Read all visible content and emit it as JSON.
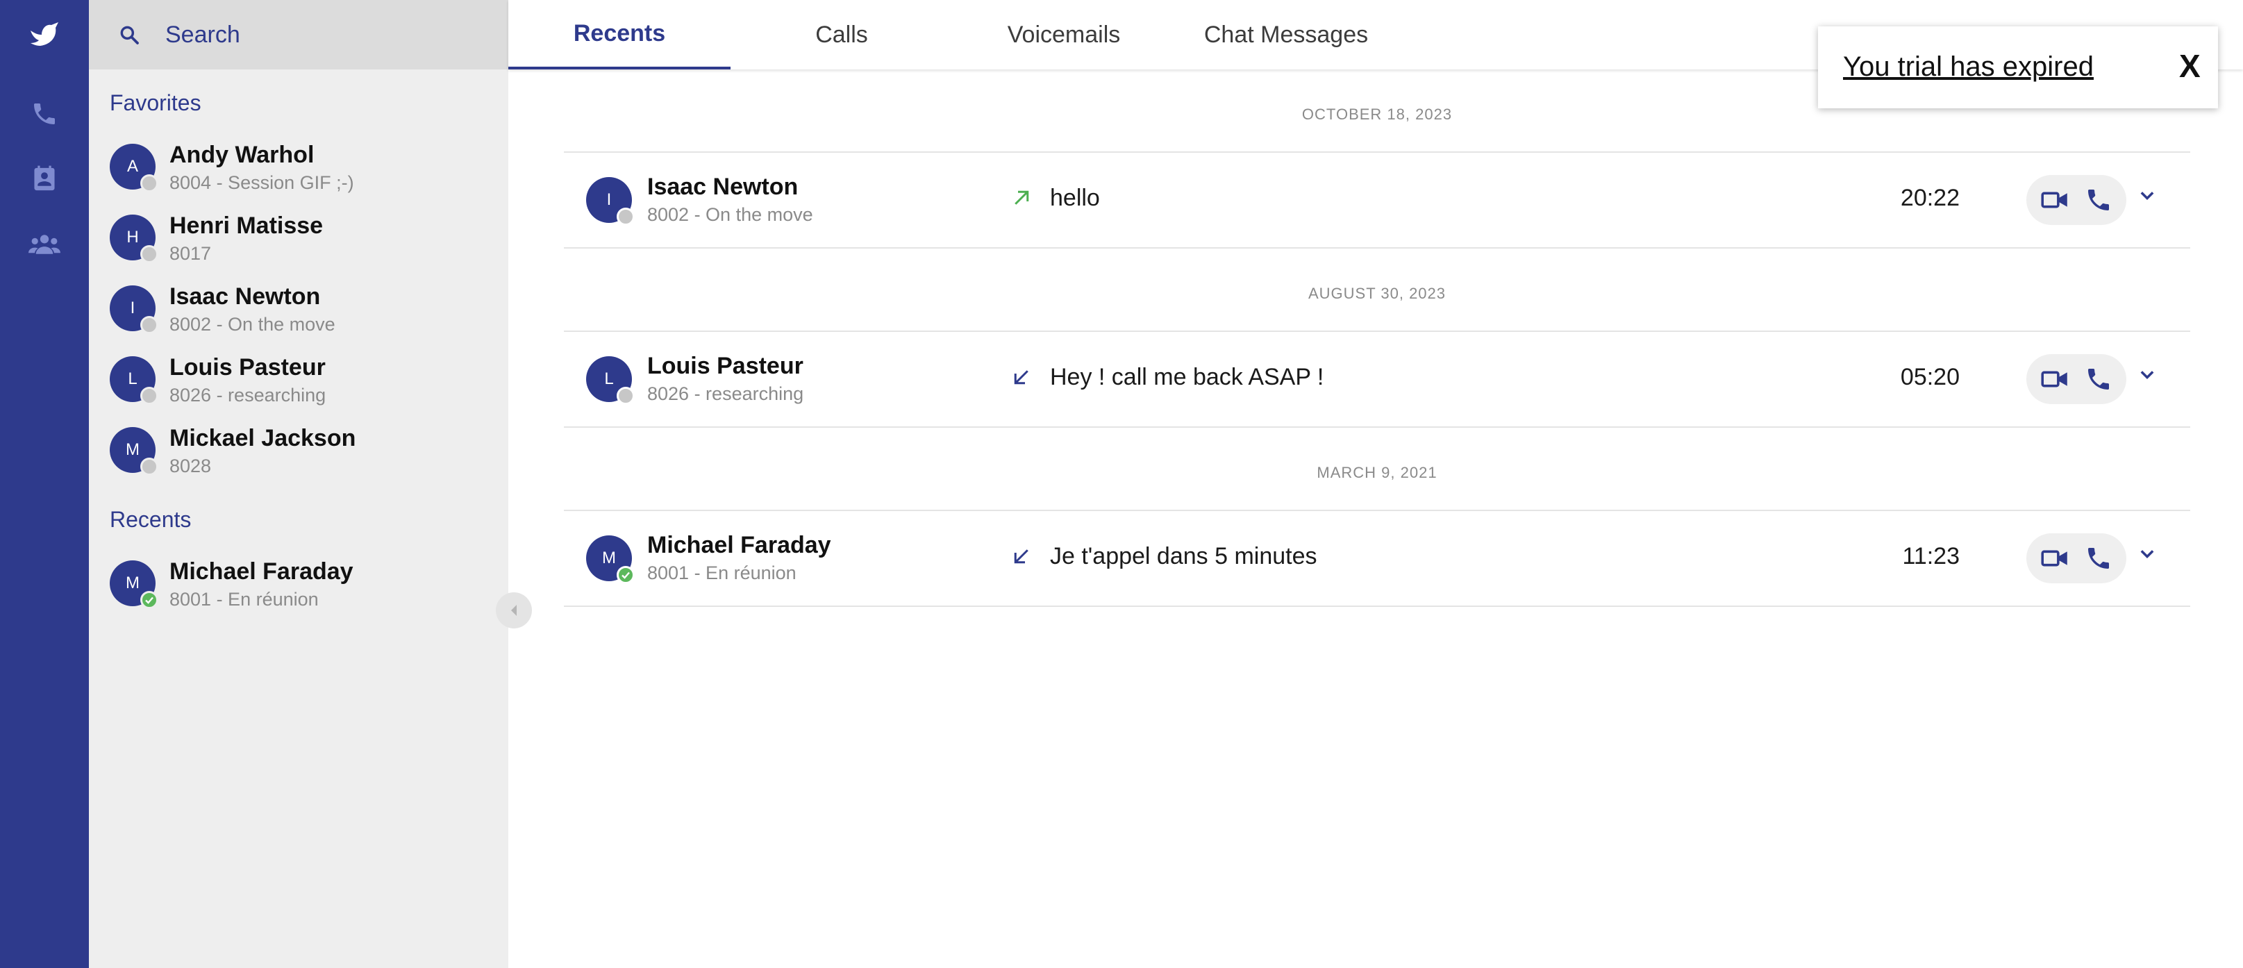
{
  "rail": {
    "items": [
      {
        "icon": "bird-logo-icon"
      },
      {
        "icon": "phone-icon"
      },
      {
        "icon": "contact-book-icon"
      },
      {
        "icon": "group-icon"
      }
    ]
  },
  "sidebar": {
    "search": {
      "placeholder": "Search"
    },
    "favorites_title": "Favorites",
    "favorites": [
      {
        "initial": "A",
        "name": "Andy Warhol",
        "sub": "8004 - Session GIF ;-)",
        "status": "offline"
      },
      {
        "initial": "H",
        "name": "Henri Matisse",
        "sub": "8017",
        "status": "offline"
      },
      {
        "initial": "I",
        "name": "Isaac Newton",
        "sub": "8002 - On the move",
        "status": "offline"
      },
      {
        "initial": "L",
        "name": "Louis Pasteur",
        "sub": "8026 - researching",
        "status": "offline"
      },
      {
        "initial": "M",
        "name": "Mickael Jackson",
        "sub": "8028",
        "status": "offline"
      }
    ],
    "recents_title": "Recents",
    "recents": [
      {
        "initial": "M",
        "name": "Michael Faraday",
        "sub": "8001 - En réunion",
        "status": "online"
      }
    ]
  },
  "tabs": [
    {
      "label": "Recents",
      "active": true
    },
    {
      "label": "Calls",
      "active": false
    },
    {
      "label": "Voicemails",
      "active": false
    },
    {
      "label": "Chat Messages",
      "active": false
    }
  ],
  "recents": [
    {
      "date": "OCTOBER 18, 2023",
      "initial": "I",
      "name": "Isaac Newton",
      "sub": "8002 - On the move",
      "status": "offline",
      "direction": "outgoing",
      "message": "hello",
      "time": "20:22"
    },
    {
      "date": "AUGUST 30, 2023",
      "initial": "L",
      "name": "Louis Pasteur",
      "sub": "8026 - researching",
      "status": "offline",
      "direction": "incoming",
      "message": "Hey ! call me back ASAP !",
      "time": "05:20"
    },
    {
      "date": "MARCH 9, 2021",
      "initial": "M",
      "name": "Michael Faraday",
      "sub": "8001 - En réunion",
      "status": "online",
      "direction": "incoming",
      "message": "Je t'appel dans 5 minutes",
      "time": "11:23"
    }
  ],
  "toast": {
    "message": "You trial has expired",
    "close_label": "X"
  },
  "colors": {
    "brand": "#2e3a8c",
    "online": "#5cb85c",
    "offline": "#c7c7c7",
    "outgoing_arrow": "#4caf50",
    "incoming_arrow": "#2e3a8c"
  }
}
